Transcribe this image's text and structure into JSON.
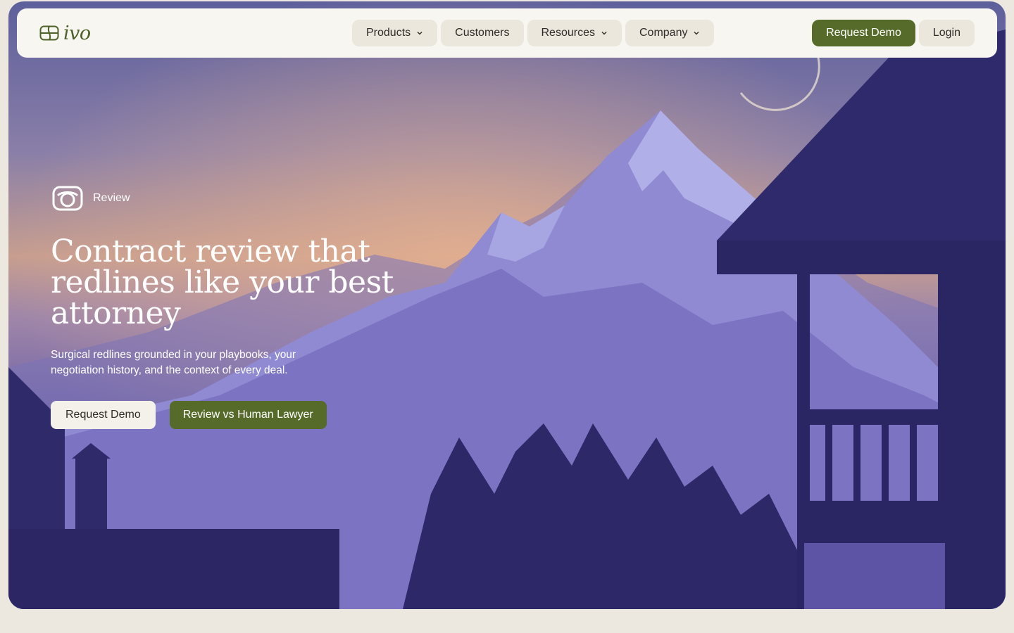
{
  "brand": {
    "name": "ivo",
    "logo_icon": "ivo-logo-icon",
    "accent": "#566b2a"
  },
  "nav": {
    "items": [
      {
        "label": "Products",
        "has_dropdown": true
      },
      {
        "label": "Customers",
        "has_dropdown": false
      },
      {
        "label": "Resources",
        "has_dropdown": true
      },
      {
        "label": "Company",
        "has_dropdown": true
      }
    ],
    "request_demo": "Request Demo",
    "login": "Login"
  },
  "hero": {
    "badge_icon": "review-icon",
    "badge_label": "Review",
    "headline": "Contract review that redlines like your best attorney",
    "subtext": "Surgical redlines grounded in your playbooks, your negotiation history, and the context of every deal.",
    "cta_primary": "Request Demo",
    "cta_secondary": "Review vs Human Lawyer"
  }
}
